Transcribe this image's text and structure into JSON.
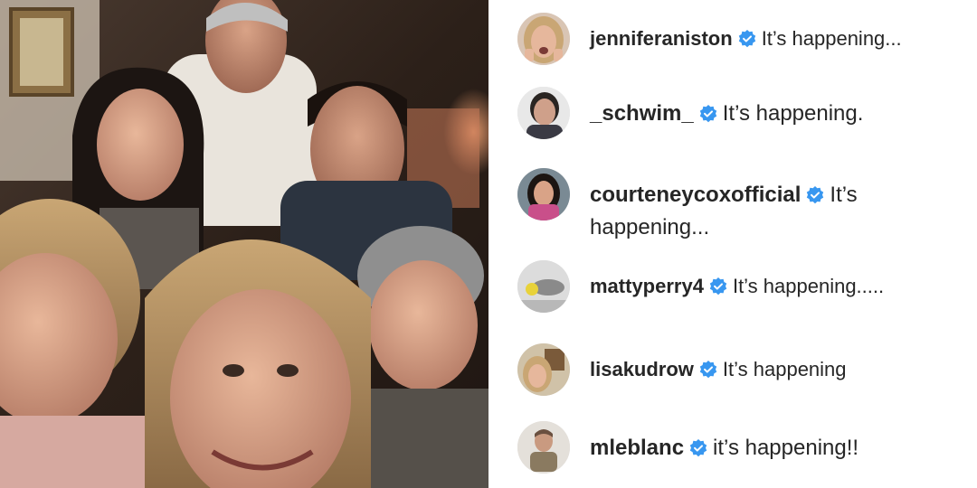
{
  "photo": {
    "description_icon": "group-selfie-photo"
  },
  "colors": {
    "verified_blue": "#3897f0",
    "text": "#262626"
  },
  "comments": [
    {
      "username": "jenniferaniston",
      "verified": true,
      "message": "It’s happening...",
      "avatar_icon": "avatar-jenniferaniston"
    },
    {
      "username": "_schwim_",
      "verified": true,
      "message": "It’s happening.",
      "avatar_icon": "avatar-schwim"
    },
    {
      "username": "courteneycoxofficial",
      "verified": true,
      "message": "It’s happening...",
      "avatar_icon": "avatar-courteneycoxofficial"
    },
    {
      "username": "mattyperry4",
      "verified": true,
      "message": "It’s happening.....",
      "avatar_icon": "avatar-mattyperry4"
    },
    {
      "username": "lisakudrow",
      "verified": true,
      "message": "It’s happening",
      "avatar_icon": "avatar-lisakudrow"
    },
    {
      "username": "mleblanc",
      "verified": true,
      "message": "it’s happening!!",
      "avatar_icon": "avatar-mleblanc"
    }
  ]
}
